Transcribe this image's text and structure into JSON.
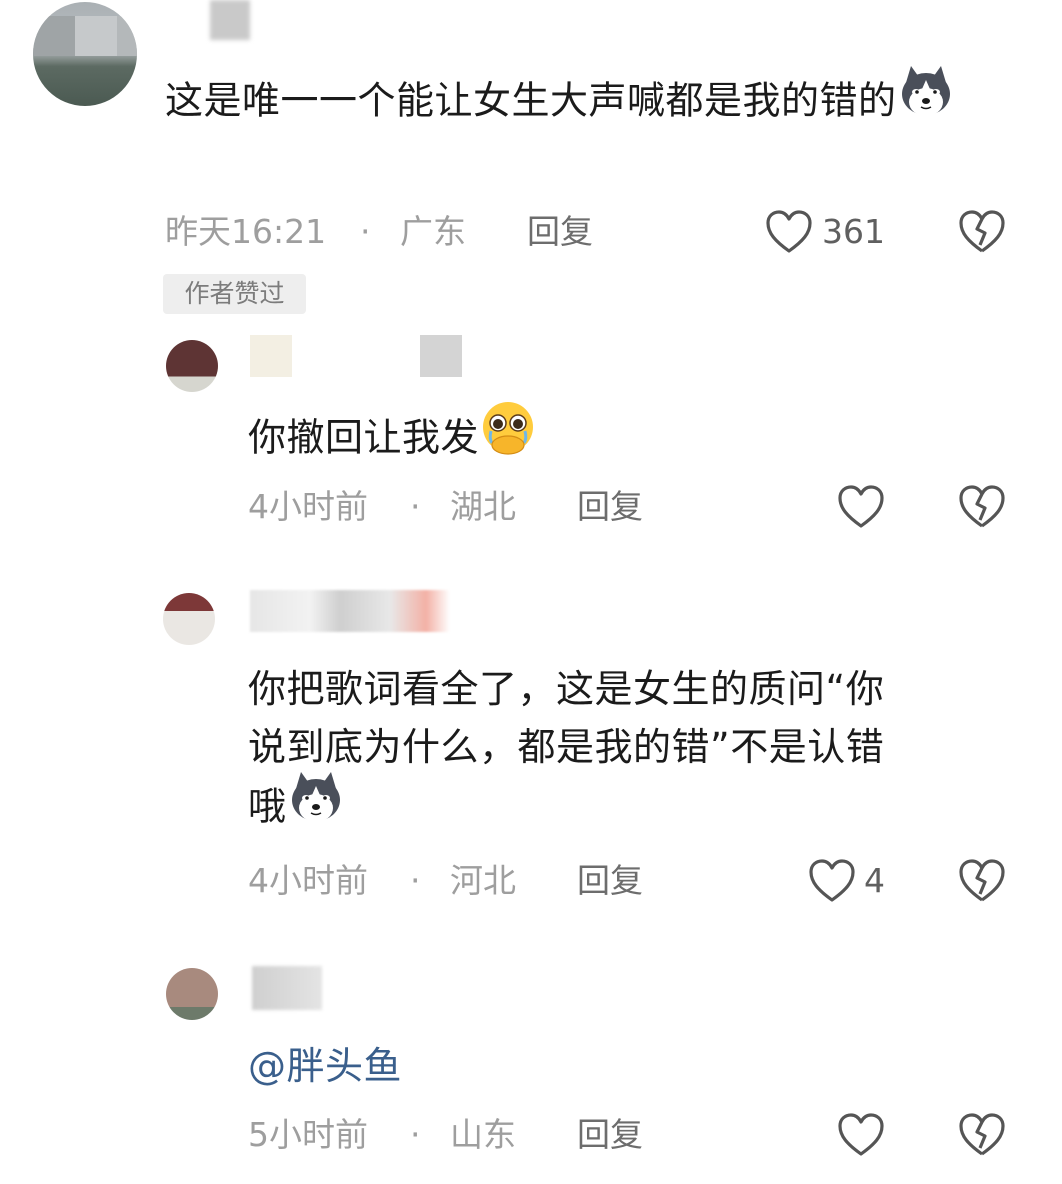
{
  "comments": [
    {
      "text": "这是唯一一个能让女生大声喊都是我的错的",
      "time": "昨天16:21",
      "dot": "·",
      "location": "广东",
      "reply_label": "回复",
      "likes": "361",
      "badge": "作者赞过",
      "emoji": "husky-face"
    },
    {
      "text": "你撤回让我发",
      "time": "4小时前",
      "dot": "·",
      "location": "湖北",
      "reply_label": "回复",
      "likes": "",
      "emoji": "pleading-face"
    },
    {
      "text_line1": "你把歌词看全了，这是女生的质问“你",
      "text_line2": "说到底为什么，都是我的错”不是认错",
      "text_line3": "哦",
      "time": "4小时前",
      "dot": "·",
      "location": "河北",
      "reply_label": "回复",
      "likes": "4",
      "emoji": "husky-face"
    },
    {
      "text": "@胖头鱼",
      "time": "5小时前",
      "dot": "·",
      "location": "山东",
      "reply_label": "回复",
      "likes": ""
    }
  ],
  "colors": {
    "text": "#1b1b1b",
    "meta": "#9e9e9e",
    "reply": "#6d6d6d",
    "mention": "#3a5f8c",
    "icon": "#555555"
  }
}
